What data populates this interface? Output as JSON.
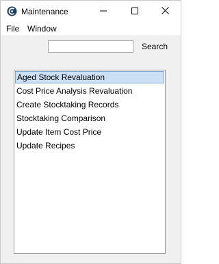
{
  "window": {
    "title": "Maintenance",
    "icon": "app-logo-icon",
    "controls": [
      "minimize-icon",
      "maximize-icon",
      "close-icon"
    ]
  },
  "menu": {
    "items": [
      "File",
      "Window"
    ]
  },
  "search": {
    "value": "",
    "placeholder": "",
    "button_label": "Search"
  },
  "list": {
    "selected_index": 0,
    "items": [
      "Aged Stock Revaluation",
      "Cost Price Analysis Revaluation",
      "Create Stocktaking Records",
      "Stocktaking Comparison",
      "Update Item Cost Price",
      "Update Recipes"
    ]
  },
  "colors": {
    "selection_fill": "#cce0f5",
    "selection_border": "#7ea8d8",
    "window_background": "#f0f0f0"
  }
}
